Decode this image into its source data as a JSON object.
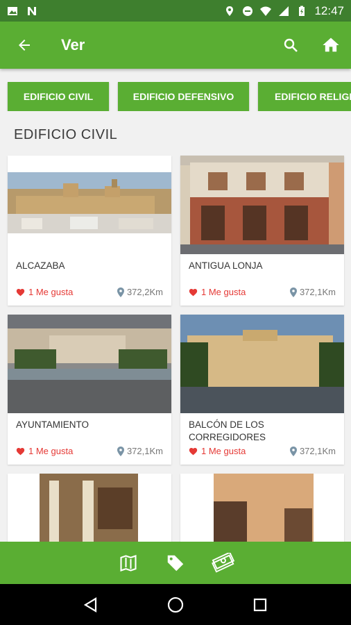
{
  "status": {
    "time": "12:47"
  },
  "appbar": {
    "title": "Ver"
  },
  "chips": [
    {
      "label": "EDIFICIO CIVIL"
    },
    {
      "label": "EDIFICIO DEFENSIVO"
    },
    {
      "label": "EDIFICIO RELIGI"
    }
  ],
  "section": {
    "title": "EDIFICIO CIVIL"
  },
  "cards": [
    {
      "name": "ALCAZABA",
      "likes": "1 Me gusta",
      "distance": "372,2Km"
    },
    {
      "name": "ANTIGUA LONJA",
      "likes": "1 Me gusta",
      "distance": "372,1Km"
    },
    {
      "name": "AYUNTAMIENTO",
      "likes": "1 Me gusta",
      "distance": "372,1Km"
    },
    {
      "name": "BALCÓN DE LOS CORREGIDORES",
      "likes": "1 Me gusta",
      "distance": "372,1Km"
    },
    {
      "name": "",
      "likes": "",
      "distance": ""
    },
    {
      "name": "",
      "likes": "",
      "distance": ""
    }
  ],
  "icons": {
    "back": "arrow-left-icon",
    "search": "search-icon",
    "home": "home-icon",
    "map": "map-icon",
    "tag": "tag-icon",
    "money": "money-icon",
    "like": "heart-icon",
    "location": "location-pin-icon"
  },
  "colors": {
    "accent": "#5aae33",
    "statusbar": "#3e7f2e",
    "like": "#e53935"
  }
}
